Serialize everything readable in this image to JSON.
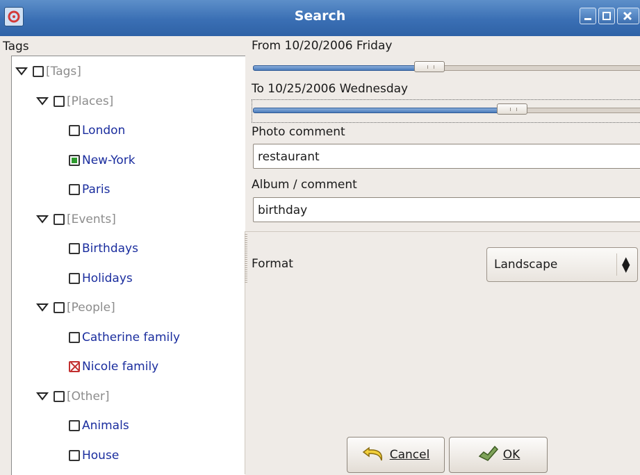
{
  "window": {
    "title": "Search"
  },
  "tags_label": "Tags",
  "tree": [
    {
      "label": "[Tags]",
      "kind": "category",
      "state": "none"
    },
    {
      "label": "[Places]",
      "kind": "category",
      "state": "none"
    },
    {
      "label": "London",
      "kind": "leaf",
      "state": "none"
    },
    {
      "label": "New-York",
      "kind": "leaf",
      "state": "checked"
    },
    {
      "label": "Paris",
      "kind": "leaf",
      "state": "none"
    },
    {
      "label": "[Events]",
      "kind": "category",
      "state": "none"
    },
    {
      "label": "Birthdays",
      "kind": "leaf",
      "state": "none"
    },
    {
      "label": "Holidays",
      "kind": "leaf",
      "state": "none"
    },
    {
      "label": "[People]",
      "kind": "category",
      "state": "none"
    },
    {
      "label": "Catherine family",
      "kind": "leaf",
      "state": "none"
    },
    {
      "label": "Nicole family",
      "kind": "leaf",
      "state": "excluded"
    },
    {
      "label": "[Other]",
      "kind": "category",
      "state": "none"
    },
    {
      "label": "Animals",
      "kind": "leaf",
      "state": "none"
    },
    {
      "label": "House",
      "kind": "leaf",
      "state": "none"
    }
  ],
  "from": {
    "label": "From 10/20/2006 Friday",
    "position": 0.45
  },
  "to": {
    "label": "To 10/25/2006 Wednesday",
    "position": 0.68
  },
  "photo_comment": {
    "label": "Photo comment",
    "value": "restaurant"
  },
  "album_comment": {
    "label": "Album / comment",
    "value": "birthday"
  },
  "format": {
    "label": "Format",
    "value": "Landscape"
  },
  "buttons": {
    "cancel": "Cancel",
    "ok": "OK"
  },
  "colors": {
    "titlebar": "#3a6fb4",
    "leaf_text": "#1a2d9e",
    "category_text": "#8c8c8c",
    "checked": "#2e9a2e",
    "excluded": "#c23030"
  }
}
